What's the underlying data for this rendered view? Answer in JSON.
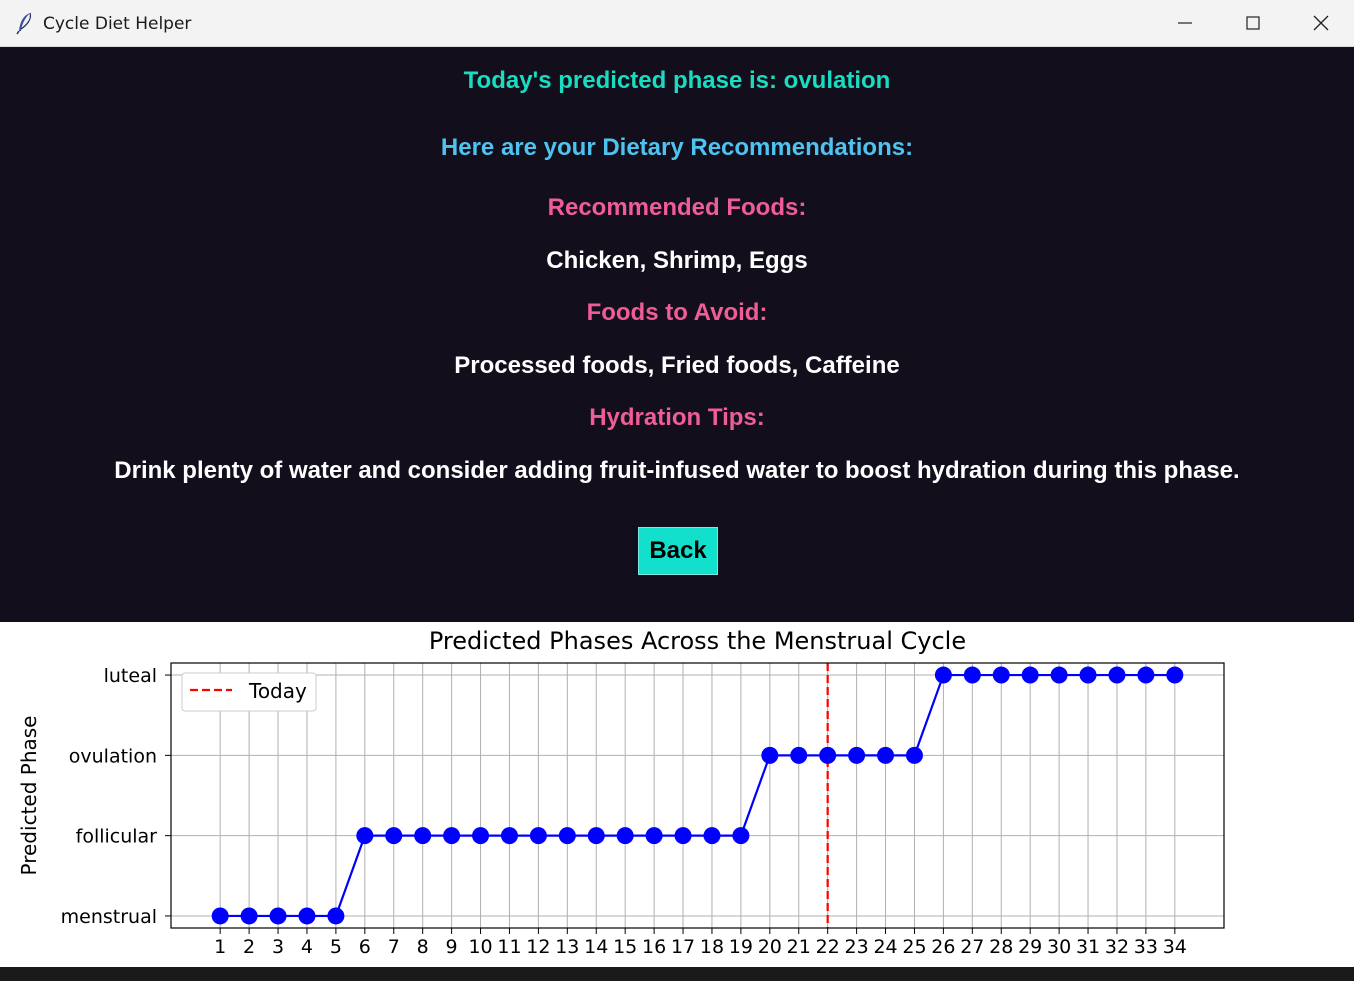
{
  "window": {
    "title": "Cycle Diet Helper",
    "icons": {
      "app": "feather-icon",
      "minimize": "minimize-icon",
      "maximize": "maximize-icon",
      "close": "close-icon"
    }
  },
  "main": {
    "phase_text": "Today's predicted phase is: ovulation",
    "recommendations_heading": "Here are your Dietary Recommendations:",
    "recommended_label": "Recommended Foods:",
    "recommended_foods": "Chicken, Shrimp, Eggs",
    "avoid_label": "Foods to Avoid:",
    "avoid_foods": "Processed foods, Fried foods, Caffeine",
    "hydration_label": "Hydration Tips:",
    "hydration_tip": "Drink plenty of water and consider adding fruit-infused water to boost hydration during this phase.",
    "back_label": "Back"
  },
  "colors": {
    "panel_bg": "#120e1b",
    "phase_text": "#19dcc0",
    "heading": "#4fc3f0",
    "section_label": "#ef5d98",
    "body_text": "#ffffff",
    "back_button": "#12e0cc",
    "series": "#0000ff",
    "today_line": "#ff0000"
  },
  "chart_data": {
    "type": "line",
    "title": "Predicted Phases Across the Menstrual Cycle",
    "xlabel": "",
    "ylabel": "Predicted Phase",
    "categories_y": [
      "menstrual",
      "follicular",
      "ovulation",
      "luteal"
    ],
    "x": [
      1,
      2,
      3,
      4,
      5,
      6,
      7,
      8,
      9,
      10,
      11,
      12,
      13,
      14,
      15,
      16,
      17,
      18,
      19,
      20,
      21,
      22,
      23,
      24,
      25,
      26,
      27,
      28,
      29,
      30,
      31,
      32,
      33,
      34
    ],
    "series": [
      {
        "values": [
          "menstrual",
          "menstrual",
          "menstrual",
          "menstrual",
          "menstrual",
          "follicular",
          "follicular",
          "follicular",
          "follicular",
          "follicular",
          "follicular",
          "follicular",
          "follicular",
          "follicular",
          "follicular",
          "follicular",
          "follicular",
          "follicular",
          "follicular",
          "ovulation",
          "ovulation",
          "ovulation",
          "ovulation",
          "ovulation",
          "ovulation",
          "luteal",
          "luteal",
          "luteal",
          "luteal",
          "luteal",
          "luteal",
          "luteal",
          "luteal",
          "luteal"
        ],
        "color": "#0000ff"
      }
    ],
    "today_line": {
      "x": 22,
      "label": "Today",
      "color": "#ff0000",
      "style": "dashed"
    },
    "legend": {
      "position": "top-left",
      "entries": [
        "Today"
      ]
    },
    "grid": true
  }
}
